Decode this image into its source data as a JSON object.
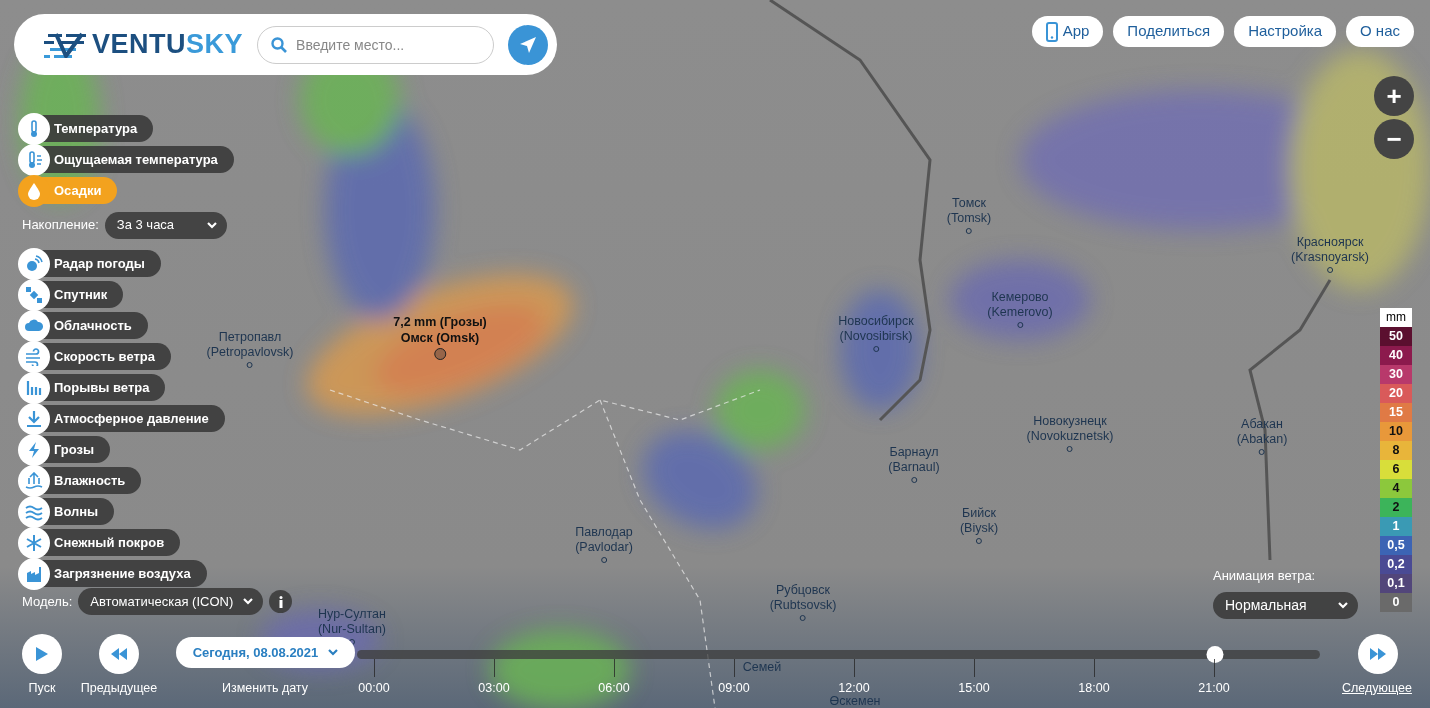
{
  "logo": {
    "dark": "VENTU",
    "light": "SKY"
  },
  "search": {
    "placeholder": "Введите место..."
  },
  "top_buttons": [
    {
      "label": "App",
      "kind": "app"
    },
    {
      "label": "Поделиться",
      "kind": "plain"
    },
    {
      "label": "Настройка",
      "kind": "plain"
    },
    {
      "label": "О нас",
      "kind": "plain"
    }
  ],
  "zoom": {
    "in": "+",
    "out": "−"
  },
  "layers": [
    {
      "label": "Температура",
      "selected": false
    },
    {
      "label": "Ощущаемая температура",
      "selected": false
    },
    {
      "label": "Осадки",
      "selected": true
    },
    {
      "label": "Радар погоды",
      "selected": false
    },
    {
      "label": "Спутник",
      "selected": false
    },
    {
      "label": "Облачность",
      "selected": false
    },
    {
      "label": "Скорость ветра",
      "selected": false
    },
    {
      "label": "Порывы ветра",
      "selected": false
    },
    {
      "label": "Атмосферное давление",
      "selected": false
    },
    {
      "label": "Грозы",
      "selected": false
    },
    {
      "label": "Влажность",
      "selected": false
    },
    {
      "label": "Волны",
      "selected": false
    },
    {
      "label": "Снежный покров",
      "selected": false
    },
    {
      "label": "Загрязнение воздуха",
      "selected": false
    }
  ],
  "accumulation": {
    "label": "Накопление:",
    "value": "За 3 часа"
  },
  "model": {
    "label": "Модель:",
    "value": "Автоматическая (ICON)"
  },
  "popup": {
    "value": "7,2 mm (Грозы)",
    "place": "Омск (Omsk)"
  },
  "cities": [
    {
      "name": "Томск",
      "latin": "(Tomsk)"
    },
    {
      "name": "Красноярск",
      "latin": "(Krasnoyarsk)"
    },
    {
      "name": "Кемерово",
      "latin": "(Kemerovo)"
    },
    {
      "name": "Новосибирск",
      "latin": "(Novosibirsk)"
    },
    {
      "name": "Петропавл",
      "latin": "(Petropavlovsk)"
    },
    {
      "name": "Новокузнецк",
      "latin": "(Novokuznetsk)"
    },
    {
      "name": "Абакан",
      "latin": "(Abakan)"
    },
    {
      "name": "Барнаул",
      "latin": "(Barnaul)"
    },
    {
      "name": "Бийск",
      "latin": "(Biysk)"
    },
    {
      "name": "Павлодар",
      "latin": "(Pavlodar)"
    },
    {
      "name": "Рубцовск",
      "latin": "(Rubtsovsk)"
    },
    {
      "name": "Нур-Султан",
      "latin": "(Nur-Sultan)"
    },
    {
      "name": "Семей"
    },
    {
      "name": "Өскемен"
    }
  ],
  "legend": {
    "unit": "mm",
    "items": [
      {
        "value": "50",
        "color": "#5b0f2f"
      },
      {
        "value": "40",
        "color": "#8c1a4d"
      },
      {
        "value": "30",
        "color": "#b8396b"
      },
      {
        "value": "20",
        "color": "#d95a5a"
      },
      {
        "value": "15",
        "color": "#e07a45"
      },
      {
        "value": "10",
        "color": "#e8983a"
      },
      {
        "value": "8",
        "color": "#e8b53a"
      },
      {
        "value": "6",
        "color": "#d8de3a"
      },
      {
        "value": "4",
        "color": "#8cc83c"
      },
      {
        "value": "2",
        "color": "#3cb45a"
      },
      {
        "value": "1",
        "color": "#3a9ab4"
      },
      {
        "value": "0,5",
        "color": "#3c64b4"
      },
      {
        "value": "0,2",
        "color": "#4a4a94"
      },
      {
        "value": "0,1",
        "color": "#52467a"
      },
      {
        "value": "0",
        "color": "#6a6a6a"
      }
    ]
  },
  "wind_animation": {
    "label": "Анимация ветра:",
    "value": "Нормальная"
  },
  "timeline": {
    "play": "Пуск",
    "previous": "Предыдущее",
    "date": "Сегодня, 08.08.2021",
    "change_date": "Изменить дату",
    "next": "Следующее",
    "level": 0.891,
    "ticks": [
      "00:00",
      "03:00",
      "06:00",
      "09:00",
      "12:00",
      "15:00",
      "18:00",
      "21:00"
    ]
  }
}
